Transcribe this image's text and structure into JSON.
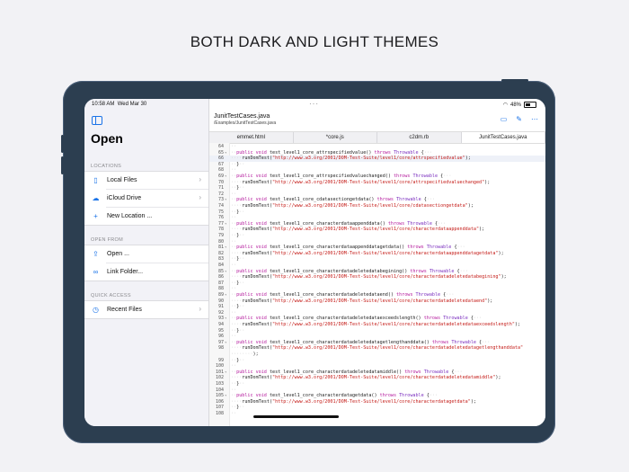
{
  "headline": "BOTH DARK AND LIGHT THEMES",
  "status": {
    "time": "10:58 AM",
    "date": "Wed Mar 30",
    "battery": "48%"
  },
  "sidebar": {
    "title": "Open",
    "locations_label": "LOCATIONS",
    "locations": [
      {
        "label": "Local Files",
        "icon": "phone-icon"
      },
      {
        "label": "iCloud Drive",
        "icon": "cloud-icon"
      },
      {
        "label": "New Location ...",
        "icon": "plus-icon"
      }
    ],
    "open_from_label": "OPEN FROM",
    "open_from": [
      {
        "label": "Open ...",
        "icon": "share-icon"
      },
      {
        "label": "Link Folder...",
        "icon": "link-icon"
      }
    ],
    "quick_access_label": "QUICK ACCESS",
    "quick_access": [
      {
        "label": "Recent Files",
        "icon": "clock-icon"
      }
    ]
  },
  "editor": {
    "file_title": "JunitTestCases.java",
    "file_path": "/Examples/JunitTestCases.java",
    "tabs": [
      "emmet.html",
      "*core.js",
      "c2dm.rb",
      "JunitTestCases.java"
    ],
    "active_tab": 3
  },
  "code": [
    {
      "n": "64",
      "fold": "",
      "parts": [
        [
          "dot",
          "··"
        ]
      ]
    },
    {
      "n": "65",
      "fold": "▾",
      "parts": [
        [
          "dot",
          "··"
        ],
        [
          "kw",
          "public void "
        ],
        [
          "",
          "test_level1_core_attrspecifiedvalue() "
        ],
        [
          "kw",
          "throws "
        ],
        [
          "ty",
          "Throwable"
        ],
        [
          "",
          " {"
        ],
        [
          "dot",
          "···"
        ]
      ]
    },
    {
      "n": "66",
      "fold": "",
      "cur": true,
      "parts": [
        [
          "dot",
          "····"
        ],
        [
          "",
          "runDomTest("
        ],
        [
          "str",
          "\"http://www.w3.org/2001/DOM-Test-Suite/level1/core/attrspecifiedvalue\""
        ],
        [
          "",
          ");"
        ]
      ]
    },
    {
      "n": "67",
      "fold": "",
      "parts": [
        [
          "dot",
          "··"
        ],
        [
          "",
          "}"
        ],
        [
          "dot",
          "··"
        ]
      ]
    },
    {
      "n": "68",
      "fold": "",
      "parts": [
        [
          "dot",
          "··"
        ]
      ]
    },
    {
      "n": "69",
      "fold": "▾",
      "parts": [
        [
          "dot",
          "··"
        ],
        [
          "kw",
          "public void "
        ],
        [
          "",
          "test_level1_core_attrspecifiedvaluechanged() "
        ],
        [
          "kw",
          "throws "
        ],
        [
          "ty",
          "Throwable"
        ],
        [
          "",
          " {"
        ],
        [
          "dot",
          "···"
        ]
      ]
    },
    {
      "n": "70",
      "fold": "",
      "parts": [
        [
          "dot",
          "····"
        ],
        [
          "",
          "runDomTest("
        ],
        [
          "str",
          "\"http://www.w3.org/2001/DOM-Test-Suite/level1/core/attrspecifiedvaluechanged\""
        ],
        [
          "",
          ");"
        ]
      ]
    },
    {
      "n": "71",
      "fold": "",
      "parts": [
        [
          "dot",
          "··"
        ],
        [
          "",
          "}"
        ],
        [
          "dot",
          "··"
        ]
      ]
    },
    {
      "n": "72",
      "fold": "",
      "parts": [
        [
          "dot",
          "··"
        ]
      ]
    },
    {
      "n": "73",
      "fold": "▾",
      "parts": [
        [
          "dot",
          "··"
        ],
        [
          "kw",
          "public void "
        ],
        [
          "",
          "test_level1_core_cdatasectiongetdata() "
        ],
        [
          "kw",
          "throws "
        ],
        [
          "ty",
          "Throwable"
        ],
        [
          "",
          " {"
        ],
        [
          "dot",
          "···"
        ]
      ]
    },
    {
      "n": "74",
      "fold": "",
      "parts": [
        [
          "dot",
          "····"
        ],
        [
          "",
          "runDomTest("
        ],
        [
          "str",
          "\"http://www.w3.org/2001/DOM-Test-Suite/level1/core/cdatasectiongetdata\""
        ],
        [
          "",
          ");"
        ]
      ]
    },
    {
      "n": "75",
      "fold": "",
      "parts": [
        [
          "dot",
          "··"
        ],
        [
          "",
          "}"
        ],
        [
          "dot",
          "··"
        ]
      ]
    },
    {
      "n": "76",
      "fold": "",
      "parts": [
        [
          "dot",
          "··"
        ]
      ]
    },
    {
      "n": "77",
      "fold": "▾",
      "parts": [
        [
          "dot",
          "··"
        ],
        [
          "kw",
          "public void "
        ],
        [
          "",
          "test_level1_core_characterdataappenddata() "
        ],
        [
          "kw",
          "throws "
        ],
        [
          "ty",
          "Throwable"
        ],
        [
          "",
          " {"
        ],
        [
          "dot",
          "···"
        ]
      ]
    },
    {
      "n": "78",
      "fold": "",
      "parts": [
        [
          "dot",
          "····"
        ],
        [
          "",
          "runDomTest("
        ],
        [
          "str",
          "\"http://www.w3.org/2001/DOM-Test-Suite/level1/core/characterdataappenddata\""
        ],
        [
          "",
          ");"
        ]
      ]
    },
    {
      "n": "79",
      "fold": "",
      "parts": [
        [
          "dot",
          "··"
        ],
        [
          "",
          "}"
        ],
        [
          "dot",
          "··"
        ]
      ]
    },
    {
      "n": "80",
      "fold": "",
      "parts": [
        [
          "dot",
          "··"
        ]
      ]
    },
    {
      "n": "81",
      "fold": "▾",
      "parts": [
        [
          "dot",
          "··"
        ],
        [
          "kw",
          "public void "
        ],
        [
          "",
          "test_level1_core_characterdataappenddatagetdata() "
        ],
        [
          "kw",
          "throws "
        ],
        [
          "ty",
          "Throwable"
        ],
        [
          "",
          " {"
        ],
        [
          "dot",
          "···"
        ]
      ]
    },
    {
      "n": "82",
      "fold": "",
      "parts": [
        [
          "dot",
          "····"
        ],
        [
          "",
          "runDomTest("
        ],
        [
          "str",
          "\"http://www.w3.org/2001/DOM-Test-Suite/level1/core/characterdataappenddatagetdata\""
        ],
        [
          "",
          ");"
        ]
      ]
    },
    {
      "n": "83",
      "fold": "",
      "parts": [
        [
          "dot",
          "··"
        ],
        [
          "",
          "}"
        ],
        [
          "dot",
          "··"
        ]
      ]
    },
    {
      "n": "84",
      "fold": "",
      "parts": [
        [
          "dot",
          "··"
        ]
      ]
    },
    {
      "n": "85",
      "fold": "▾",
      "parts": [
        [
          "dot",
          "··"
        ],
        [
          "kw",
          "public void "
        ],
        [
          "",
          "test_level1_core_characterdatadeletedatabegining() "
        ],
        [
          "kw",
          "throws "
        ],
        [
          "ty",
          "Throwable"
        ],
        [
          "",
          " {"
        ],
        [
          "dot",
          "···"
        ]
      ]
    },
    {
      "n": "86",
      "fold": "",
      "parts": [
        [
          "dot",
          "····"
        ],
        [
          "",
          "runDomTest("
        ],
        [
          "str",
          "\"http://www.w3.org/2001/DOM-Test-Suite/level1/core/characterdatadeletedatabegining\""
        ],
        [
          "",
          ");"
        ]
      ]
    },
    {
      "n": "87",
      "fold": "",
      "parts": [
        [
          "dot",
          "··"
        ],
        [
          "",
          "}"
        ],
        [
          "dot",
          "··"
        ]
      ]
    },
    {
      "n": "88",
      "fold": "",
      "parts": [
        [
          "dot",
          "··"
        ]
      ]
    },
    {
      "n": "89",
      "fold": "▾",
      "parts": [
        [
          "dot",
          "··"
        ],
        [
          "kw",
          "public void "
        ],
        [
          "",
          "test_level1_core_characterdatadeletedataend() "
        ],
        [
          "kw",
          "throws "
        ],
        [
          "ty",
          "Throwable"
        ],
        [
          "",
          " {"
        ],
        [
          "dot",
          "···"
        ]
      ]
    },
    {
      "n": "90",
      "fold": "",
      "parts": [
        [
          "dot",
          "····"
        ],
        [
          "",
          "runDomTest("
        ],
        [
          "str",
          "\"http://www.w3.org/2001/DOM-Test-Suite/level1/core/characterdatadeletedataend\""
        ],
        [
          "",
          ");"
        ]
      ]
    },
    {
      "n": "91",
      "fold": "",
      "parts": [
        [
          "dot",
          "··"
        ],
        [
          "",
          "}"
        ],
        [
          "dot",
          "··"
        ]
      ]
    },
    {
      "n": "92",
      "fold": "",
      "parts": [
        [
          "dot",
          "··"
        ]
      ]
    },
    {
      "n": "93",
      "fold": "▾",
      "parts": [
        [
          "dot",
          "··"
        ],
        [
          "kw",
          "public void "
        ],
        [
          "",
          "test_level1_core_characterdatadeletedataexceedslength() "
        ],
        [
          "kw",
          "throws "
        ],
        [
          "ty",
          "Throwable"
        ],
        [
          "",
          " {"
        ],
        [
          "dot",
          "···"
        ]
      ]
    },
    {
      "n": "94",
      "fold": "",
      "parts": [
        [
          "dot",
          "····"
        ],
        [
          "",
          "runDomTest("
        ],
        [
          "str",
          "\"http://www.w3.org/2001/DOM-Test-Suite/level1/core/characterdatadeletedataexceedslength\""
        ],
        [
          "",
          ");"
        ]
      ]
    },
    {
      "n": "95",
      "fold": "",
      "parts": [
        [
          "dot",
          "··"
        ],
        [
          "",
          "}"
        ],
        [
          "dot",
          "··"
        ]
      ]
    },
    {
      "n": "96",
      "fold": "",
      "parts": [
        [
          "dot",
          "··"
        ]
      ]
    },
    {
      "n": "97",
      "fold": "▾",
      "parts": [
        [
          "dot",
          "··"
        ],
        [
          "kw",
          "public void "
        ],
        [
          "",
          "test_level1_core_characterdatadeletedatagetlengthanddata() "
        ],
        [
          "kw",
          "throws "
        ],
        [
          "ty",
          "Throwable"
        ],
        [
          "",
          " {"
        ],
        [
          "dot",
          "···"
        ]
      ]
    },
    {
      "n": "98",
      "fold": "",
      "parts": [
        [
          "dot",
          "····"
        ],
        [
          "",
          "runDomTest("
        ],
        [
          "str",
          "\"http://www.w3.org/2001/DOM-Test-Suite/level1/core/characterdatadeletedatagetlengthanddata\""
        ]
      ]
    },
    {
      "n": "",
      "fold": "",
      "parts": [
        [
          "dot",
          "········"
        ],
        [
          "",
          ");"
        ]
      ]
    },
    {
      "n": "99",
      "fold": "",
      "parts": [
        [
          "dot",
          "··"
        ],
        [
          "",
          "}"
        ],
        [
          "dot",
          "··"
        ]
      ]
    },
    {
      "n": "100",
      "fold": "",
      "parts": [
        [
          "dot",
          "··"
        ]
      ]
    },
    {
      "n": "101",
      "fold": "▾",
      "parts": [
        [
          "dot",
          "··"
        ],
        [
          "kw",
          "public void "
        ],
        [
          "",
          "test_level1_core_characterdatadeletedatamiddle() "
        ],
        [
          "kw",
          "throws "
        ],
        [
          "ty",
          "Throwable"
        ],
        [
          "",
          " {"
        ],
        [
          "dot",
          "···"
        ]
      ]
    },
    {
      "n": "102",
      "fold": "",
      "parts": [
        [
          "dot",
          "····"
        ],
        [
          "",
          "runDomTest("
        ],
        [
          "str",
          "\"http://www.w3.org/2001/DOM-Test-Suite/level1/core/characterdatadeletedatamiddle\""
        ],
        [
          "",
          ");"
        ]
      ]
    },
    {
      "n": "103",
      "fold": "",
      "parts": [
        [
          "dot",
          "··"
        ],
        [
          "",
          "}"
        ],
        [
          "dot",
          "··"
        ]
      ]
    },
    {
      "n": "104",
      "fold": "",
      "parts": [
        [
          "dot",
          "··"
        ]
      ]
    },
    {
      "n": "105",
      "fold": "▾",
      "parts": [
        [
          "dot",
          "··"
        ],
        [
          "kw",
          "public void "
        ],
        [
          "",
          "test_level1_core_characterdatagetdata() "
        ],
        [
          "kw",
          "throws "
        ],
        [
          "ty",
          "Throwable"
        ],
        [
          "",
          " {"
        ],
        [
          "dot",
          "···"
        ]
      ]
    },
    {
      "n": "106",
      "fold": "",
      "parts": [
        [
          "dot",
          "····"
        ],
        [
          "",
          "runDomTest("
        ],
        [
          "str",
          "\"http://www.w3.org/2001/DOM-Test-Suite/level1/core/characterdatagetdata\""
        ],
        [
          "",
          ");"
        ]
      ]
    },
    {
      "n": "107",
      "fold": "",
      "parts": [
        [
          "dot",
          "··"
        ],
        [
          "",
          "}"
        ],
        [
          "dot",
          "··"
        ]
      ]
    },
    {
      "n": "108",
      "fold": "",
      "parts": [
        [
          "dot",
          "··"
        ]
      ]
    }
  ]
}
